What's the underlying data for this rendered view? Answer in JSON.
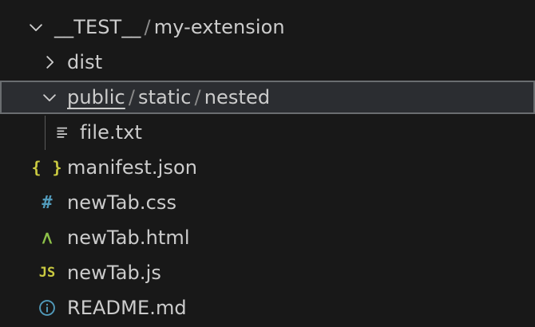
{
  "colors": {
    "background": "#181818",
    "text": "#cccccc",
    "separator": "#8a8a8a",
    "selected_bg": "#2b2d31",
    "selected_border": "#6a6d70",
    "json_icon": "#cbcb41",
    "css_icon": "#519aba",
    "html_icon": "#8dc149",
    "js_icon": "#cbcb41",
    "info_icon": "#519aba",
    "text_icon": "#cccccc"
  },
  "tree": {
    "root": {
      "segments": [
        "__TEST__",
        "my-extension"
      ],
      "separator": "/",
      "expanded": true,
      "twistie_icon": "chevron-down-icon"
    },
    "dist": {
      "label": "dist",
      "expanded": false,
      "twistie_icon": "chevron-right-icon"
    },
    "public": {
      "segments": [
        "public",
        "static",
        "nested"
      ],
      "separator": "/",
      "expanded": true,
      "selected": true,
      "twistie_icon": "chevron-down-icon"
    },
    "files": {
      "file_txt": {
        "label": "file.txt",
        "icon": "text-file-icon",
        "glyph": "≡"
      },
      "manifest": {
        "label": "manifest.json",
        "icon": "json-icon",
        "glyph": "{ }"
      },
      "css": {
        "label": "newTab.css",
        "icon": "css-hash-icon",
        "glyph": "#"
      },
      "html": {
        "label": "newTab.html",
        "icon": "html-icon",
        "glyph": "^"
      },
      "js": {
        "label": "newTab.js",
        "icon": "js-icon",
        "glyph": "JS"
      },
      "readme": {
        "label": "README.md",
        "icon": "info-icon",
        "glyph": "i"
      }
    }
  }
}
